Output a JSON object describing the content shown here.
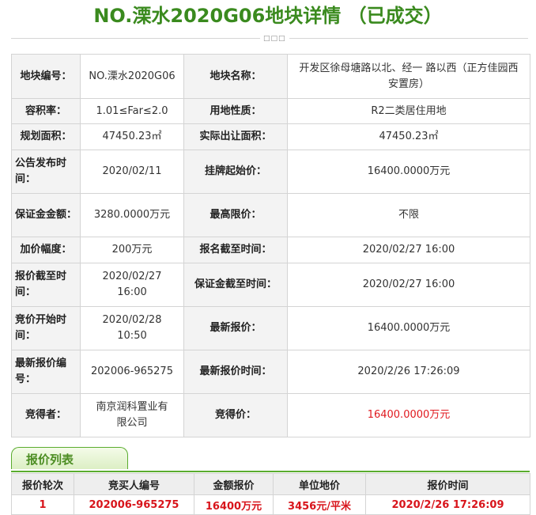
{
  "page_title": "NO.溧水2020G06地块详情 （已成交）",
  "divider_dots": "□□□",
  "info": {
    "parcel_no_label": "地块编号：",
    "parcel_no": "NO.溧水2020G06",
    "parcel_name_label": "地块名称：",
    "parcel_name": "开发区徐母塘路以北、经一 路以西（正方佳园西安置房）",
    "far_label": "容积率：",
    "far": "1.01≤Far≤2.0",
    "land_use_label": "用地性质：",
    "land_use": "R2二类居住用地",
    "planned_area_label": "规划面积：",
    "planned_area": "47450.23㎡",
    "actual_area_label": "实际出让面积：",
    "actual_area": "47450.23㎡",
    "announce_time_label": "公告发布时间：",
    "announce_time": "2020/02/11",
    "start_price_label": "挂牌起始价：",
    "start_price": "16400.0000万元",
    "deposit_label": "保证金金额：",
    "deposit": "3280.0000万元",
    "max_price_label": "最高限价：",
    "max_price": "不限",
    "increment_label": "加价幅度：",
    "increment": "200万元",
    "reg_deadline_label": "报名截至时间：",
    "reg_deadline": "2020/02/27 16:00",
    "quote_deadline_label": "报价截至时间：",
    "quote_deadline": "2020/02/27 16:00",
    "deposit_deadline_label": "保证金截至时间：",
    "deposit_deadline": "2020/02/27 16:00",
    "bidding_start_label": "竞价开始时间：",
    "bidding_start": "2020/02/28 10:50",
    "latest_price_label": "最新报价：",
    "latest_price": "16400.0000万元",
    "latest_bid_no_label": "最新报价编号：",
    "latest_bid_no": "202006-965275",
    "latest_bid_time_label": "最新报价时间：",
    "latest_bid_time": "2020/2/26 17:26:09",
    "winner_label": "竞得者：",
    "winner": "南京润科置业有限公司",
    "winning_price_label": "竞得价：",
    "winning_price": "16400.0000万元"
  },
  "bid_tab": "报价列表",
  "bid_table": {
    "headers": [
      "报价轮次",
      "竞买人编号",
      "金额报价",
      "单位地价",
      "报价时间"
    ],
    "rows": [
      [
        "1",
        "202006-965275",
        "16400万元",
        "3456元/平米",
        "2020/2/26 17:26:09"
      ]
    ]
  },
  "colors": {
    "title": "#3a8a1e",
    "highlight_red": "#e0191f",
    "tab_border": "#5aac2e"
  }
}
